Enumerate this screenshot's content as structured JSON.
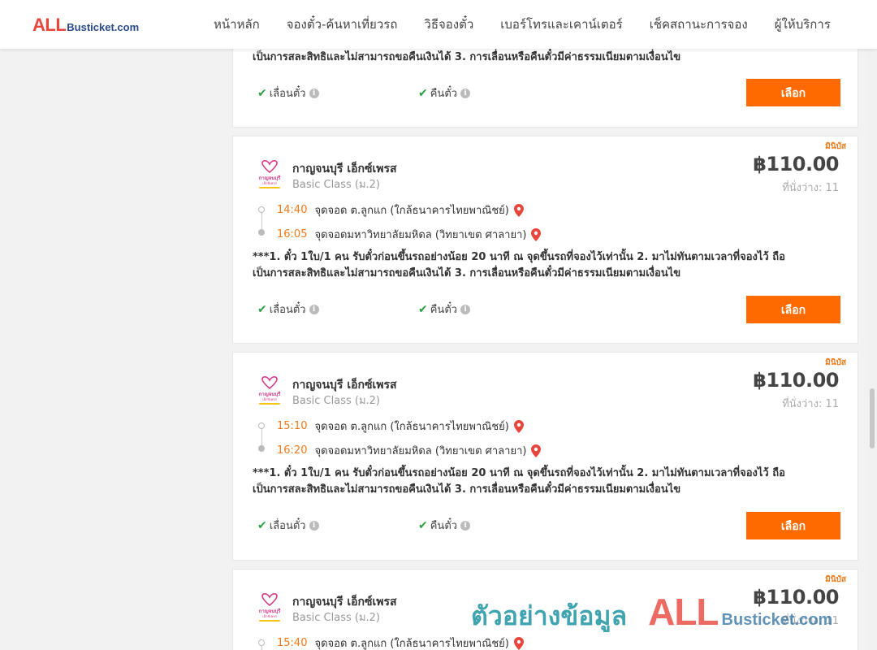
{
  "header": {
    "logo_main": "ALL",
    "logo_rest": "Busticket.com",
    "nav": [
      "หน้าหลัก",
      "จองตั๋ว-ค้นหาเที่ยวรถ",
      "วิธีจองตั๋ว",
      "เบอร์โทรและเคาน์เตอร์",
      "เช็คสถานะการจอง",
      "ผู้ให้บริการ"
    ]
  },
  "common": {
    "policy_line1": "***1. ตั๋ว 1ใบ/1 คน รับตั๋วก่อนขึ้นรถอย่างน้อย 20 นาที ณ จุดขึ้นรถที่จองไว้เท่านั้น 2. มาไม่ทันตามเวลาที่จองไว้ ถือ",
    "policy_line2": "เป็นการสละสิทธิและไม่สามารถขอคืนเงินได้ 3. การเลื่อนหรือคืนตั๋วมีค่าธรรมเนียมตามเงื่อนไข",
    "feature_change": "เลื่อนตั๋ว",
    "feature_refund": "คืนตั๋ว",
    "select_label": "เลือก",
    "info_glyph": "i",
    "check_glyph": "✔"
  },
  "cards": [
    {
      "tag": "มินิบัส",
      "logo_text": "กาญจนบุรี เอ็กซ์เพรส",
      "company": "กาญจนบุรี เอ็กซ์เพรส",
      "bus_class": "Basic Class (ม.2)",
      "price": "฿110.00",
      "seats": "ที่นั่งว่าง: 11",
      "depart_time": "14:40",
      "depart_place": "จุดจอด ต.ลูกแก (ใกล้ธนาคารไทยพาณิชย์)",
      "arrive_time": "16:05",
      "arrive_place": "จุดจอดมหาวิทยาลัยมหิดล (วิทยาเขต ศาลายา)"
    },
    {
      "tag": "มินิบัส",
      "logo_text": "กาญจนบุรี เอ็กซ์เพรส",
      "company": "กาญจนบุรี เอ็กซ์เพรส",
      "bus_class": "Basic Class (ม.2)",
      "price": "฿110.00",
      "seats": "ที่นั่งว่าง: 11",
      "depart_time": "15:10",
      "depart_place": "จุดจอด ต.ลูกแก (ใกล้ธนาคารไทยพาณิชย์)",
      "arrive_time": "16:20",
      "arrive_place": "จุดจอดมหาวิทยาลัยมหิดล (วิทยาเขต ศาลายา)"
    },
    {
      "tag": "มินิบัส",
      "logo_text": "กาญจนบุรี เอ็กซ์เพรส",
      "company": "กาญจนบุรี เอ็กซ์เพรส",
      "bus_class": "Basic Class (ม.2)",
      "price": "฿110.00",
      "seats": "ที่นั่งว่าง: 11",
      "depart_time": "15:40",
      "depart_place": "จุดจอด ต.ลูกแก (ใกล้ธนาคารไทยพาณิชย์)"
    }
  ],
  "watermark": {
    "thai": "ตัวอย่างข้อมูล",
    "all": "ALL",
    "rest": "Busticket.com"
  },
  "colors": {
    "accent": "#ff6a00",
    "time": "#f07a1a",
    "check": "#2ea043",
    "pin": "#e8453c"
  }
}
